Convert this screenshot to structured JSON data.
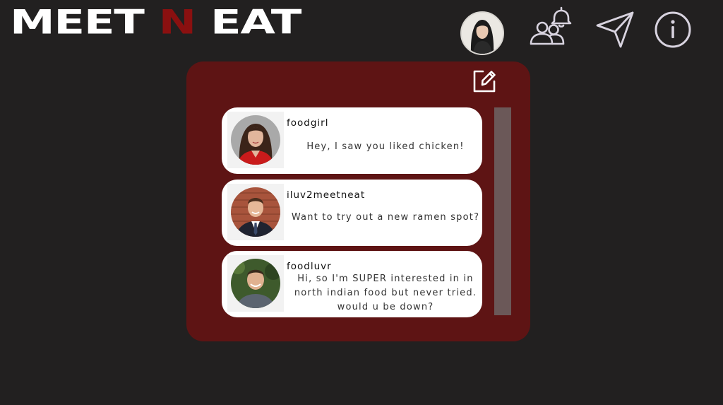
{
  "app": {
    "logo_part1": "MEET ",
    "logo_accent": "N",
    "logo_part2": " EAT"
  },
  "header": {
    "icons": [
      "profile-avatar",
      "friends-notification-icon",
      "send-icon",
      "info-icon"
    ]
  },
  "messages": {
    "compose_icon": "edit-icon",
    "items": [
      {
        "username": "foodgirl",
        "text": "Hey, I saw you liked chicken!"
      },
      {
        "username": "iluv2meetneat",
        "text": "Want to try out a new ramen spot?"
      },
      {
        "username": "foodluvr",
        "text": "Hi, so I'm SUPER interested in in north indian food but never tried. would u be down?"
      }
    ]
  },
  "colors": {
    "background": "#222020",
    "panel": "#5e1414",
    "accent": "#8a1010",
    "card": "#ffffff",
    "scrollbar": "#6b5858"
  }
}
